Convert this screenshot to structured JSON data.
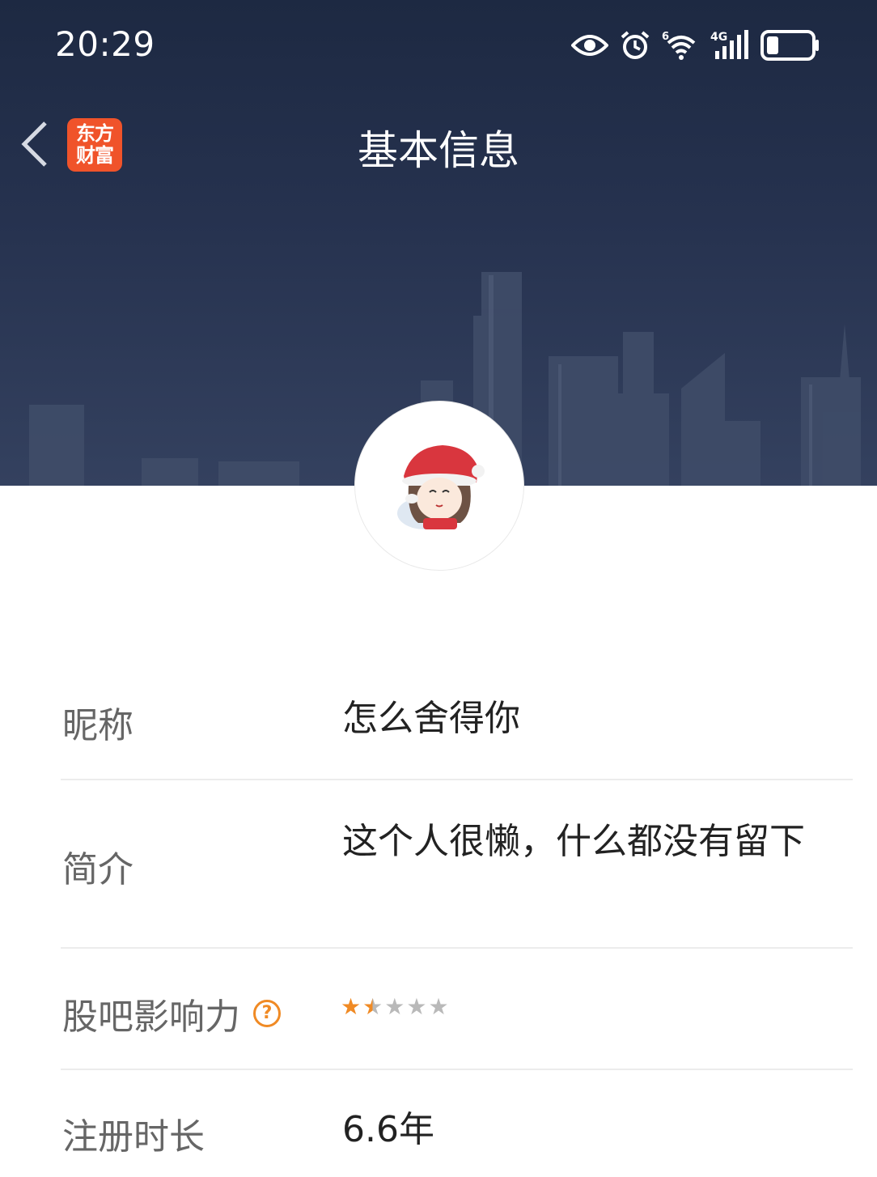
{
  "status_bar": {
    "time": "20:29",
    "network_label": "4G",
    "wifi_label": "6",
    "icons": [
      "eye-icon",
      "alarm-icon",
      "wifi-icon",
      "signal-icon",
      "battery-icon"
    ],
    "battery_level": 0.25
  },
  "nav": {
    "title": "基本信息",
    "logo_line1": "东方",
    "logo_line2": "财富",
    "back_icon": "chevron-left-icon",
    "logo_color": "#f0532a"
  },
  "profile": {
    "avatar_alt": "avatar"
  },
  "rows": [
    {
      "label": "昵称",
      "value": "怎么舍得你"
    },
    {
      "label": "简介",
      "value": "这个人很懒，什么都没有留下"
    },
    {
      "label": "股吧影响力",
      "help": "?",
      "stars": 1.5,
      "max_stars": 5
    },
    {
      "label": "注册时长",
      "value": "6.6年"
    }
  ],
  "colors": {
    "header_bg": "#1d2942",
    "accent": "#f08a24",
    "divider": "#ececec"
  }
}
